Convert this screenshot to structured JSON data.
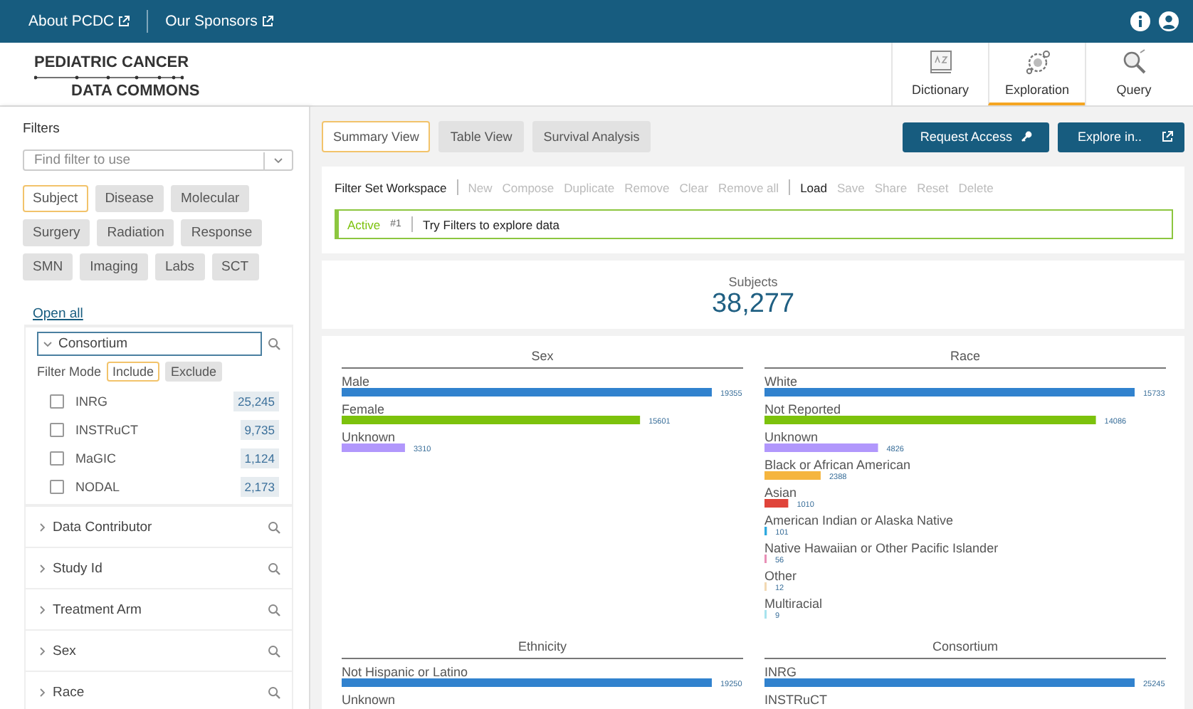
{
  "top_bar": {
    "links": [
      {
        "label": "About PCDC"
      },
      {
        "label": "Our Sponsors"
      }
    ]
  },
  "header": {
    "logo": [
      "PEDIATRIC CANCER",
      "DATA COMMONS"
    ],
    "nav": [
      {
        "label": "Dictionary",
        "kind": "book",
        "selected": false
      },
      {
        "label": "Exploration",
        "kind": "gears",
        "selected": true
      },
      {
        "label": "Query",
        "kind": "search",
        "selected": false
      }
    ]
  },
  "sidebar": {
    "title": "Filters",
    "search": {
      "placeholder": "Find filter to use"
    },
    "filter_tabs": [
      {
        "label": "Subject",
        "selected": true
      },
      {
        "label": "Disease",
        "selected": false
      },
      {
        "label": "Molecular",
        "selected": false
      },
      {
        "label": "Surgery",
        "selected": false
      },
      {
        "label": "Radiation",
        "selected": false
      },
      {
        "label": "Response",
        "selected": false
      },
      {
        "label": "SMN",
        "selected": false
      },
      {
        "label": "Imaging",
        "selected": false
      },
      {
        "label": "Labs",
        "selected": false
      },
      {
        "label": "SCT",
        "selected": false
      }
    ],
    "open_all": "Open all",
    "filters": [
      {
        "label": "Consortium",
        "expanded": true,
        "filter_mode": {
          "label": "Filter Mode",
          "options": [
            {
              "label": "Include",
              "selected": true
            },
            {
              "label": "Exclude",
              "selected": false
            }
          ]
        },
        "options": [
          {
            "label": "INRG",
            "count": "25,245",
            "checked": false
          },
          {
            "label": "INSTRuCT",
            "count": "9,735",
            "checked": false
          },
          {
            "label": "MaGIC",
            "count": "1,124",
            "checked": false
          },
          {
            "label": "NODAL",
            "count": "2,173",
            "checked": false
          }
        ]
      },
      {
        "label": "Data Contributor",
        "expanded": false
      },
      {
        "label": "Study Id",
        "expanded": false
      },
      {
        "label": "Treatment Arm",
        "expanded": false
      },
      {
        "label": "Sex",
        "expanded": false
      },
      {
        "label": "Race",
        "expanded": false
      }
    ]
  },
  "main": {
    "view_tabs": [
      {
        "label": "Summary View",
        "selected": true
      },
      {
        "label": "Table View",
        "selected": false
      },
      {
        "label": "Survival Analysis",
        "selected": false
      }
    ],
    "actions": [
      {
        "label": "Request Access",
        "kind": "key"
      },
      {
        "label": "Explore in..",
        "kind": "external"
      }
    ],
    "workspace": {
      "title": "Filter Set Workspace",
      "action_groups": [
        [
          {
            "label": "New",
            "disabled": true
          },
          {
            "label": "Compose",
            "disabled": true
          },
          {
            "label": "Duplicate",
            "disabled": true
          },
          {
            "label": "Remove",
            "disabled": true
          },
          {
            "label": "Clear",
            "disabled": true
          },
          {
            "label": "Remove all",
            "disabled": true
          }
        ],
        [
          {
            "label": "Load",
            "disabled": false
          },
          {
            "label": "Save",
            "disabled": true
          },
          {
            "label": "Share",
            "disabled": true
          },
          {
            "label": "Reset",
            "disabled": true
          },
          {
            "label": "Delete",
            "disabled": true
          }
        ]
      ],
      "active_set": {
        "status": "Active",
        "number": "#1",
        "text": "Try Filters to explore data"
      }
    },
    "summary": {
      "label": "Subjects",
      "count": "38,277"
    },
    "charts": [
      {
        "chart_data": {
          "type": "bar",
          "orientation": "horizontal",
          "title": "Sex",
          "categories": [
            "Male",
            "Female",
            "Unknown"
          ],
          "data_labels": true,
          "series": [
            {
              "color": "#3182ce",
              "values": [
                19355,
                null,
                null
              ]
            },
            {
              "color": "#7cc20c",
              "values": [
                null,
                15601,
                null
              ]
            },
            {
              "color": "#b197fc",
              "values": [
                null,
                null,
                3310
              ]
            }
          ]
        }
      },
      {
        "chart_data": {
          "type": "bar",
          "orientation": "horizontal",
          "title": "Race",
          "categories": [
            "White",
            "Not Reported",
            "Unknown",
            "Black or African American",
            "Asian",
            "American Indian or Alaska Native",
            "Native Hawaiian or Other Pacific Islander",
            "Other",
            "Multiracial"
          ],
          "data_labels": true,
          "series": [
            {
              "color": "#3182ce",
              "values": [
                15733,
                null,
                null,
                null,
                null,
                null,
                null,
                null,
                null
              ]
            },
            {
              "color": "#7cc20c",
              "values": [
                null,
                14086,
                null,
                null,
                null,
                null,
                null,
                null,
                null
              ]
            },
            {
              "color": "#b197fc",
              "values": [
                null,
                null,
                4826,
                null,
                null,
                null,
                null,
                null,
                null
              ]
            },
            {
              "color": "#f5b53f",
              "values": [
                null,
                null,
                null,
                2388,
                null,
                null,
                null,
                null,
                null
              ]
            },
            {
              "color": "#e0443a",
              "values": [
                null,
                null,
                null,
                null,
                1010,
                null,
                null,
                null,
                null
              ]
            },
            {
              "color": "#2ea9df",
              "values": [
                null,
                null,
                null,
                null,
                null,
                101,
                null,
                null,
                null
              ]
            },
            {
              "color": "#e88fb6",
              "values": [
                null,
                null,
                null,
                null,
                null,
                null,
                56,
                null,
                null
              ]
            },
            {
              "color": "#f2d9b3",
              "values": [
                null,
                null,
                null,
                null,
                null,
                null,
                null,
                12,
                null
              ]
            },
            {
              "color": "#a8e3ee",
              "values": [
                null,
                null,
                null,
                null,
                null,
                null,
                null,
                null,
                9
              ]
            }
          ]
        }
      },
      {
        "chart_data": {
          "type": "bar",
          "orientation": "horizontal",
          "title": "Ethnicity",
          "categories": [
            "Not Hispanic or Latino",
            "Unknown"
          ],
          "data_labels": true,
          "series": [
            {
              "color": "#3182ce",
              "values": [
                19250,
                null
              ]
            }
          ]
        }
      },
      {
        "chart_data": {
          "type": "bar",
          "orientation": "horizontal",
          "title": "Consortium",
          "categories": [
            "INRG",
            "INSTRuCT"
          ],
          "data_labels": true,
          "series": [
            {
              "color": "#3182ce",
              "values": [
                25245,
                null
              ]
            }
          ]
        }
      }
    ]
  }
}
